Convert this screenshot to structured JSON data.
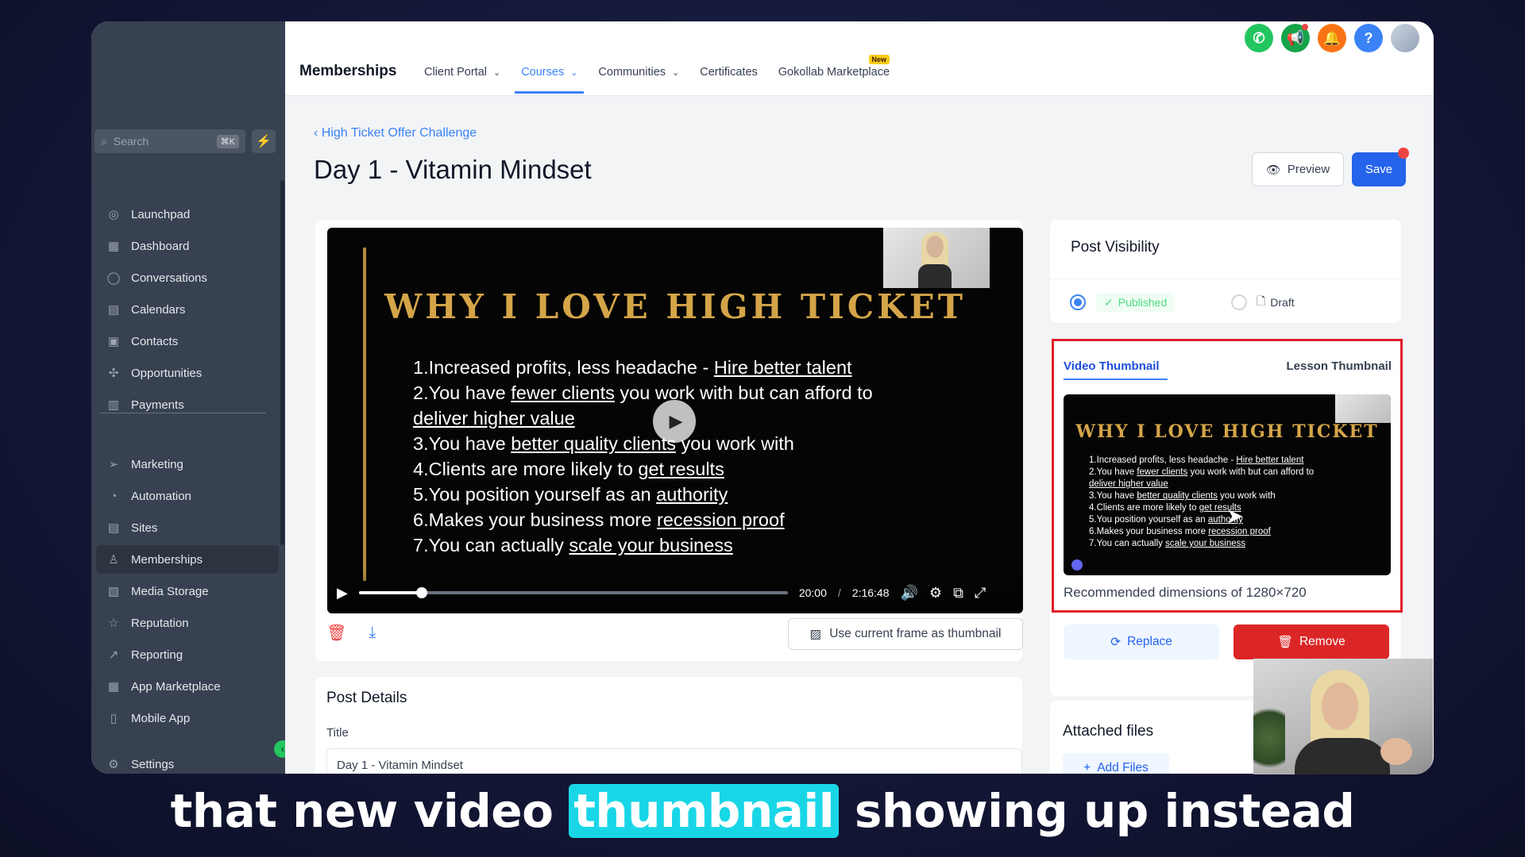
{
  "sidebar": {
    "search_placeholder": "Search",
    "search_shortcut": "⌘K",
    "items": [
      {
        "label": "Launchpad",
        "icon": "launchpad-icon"
      },
      {
        "label": "Dashboard",
        "icon": "dashboard-icon"
      },
      {
        "label": "Conversations",
        "icon": "chat-icon"
      },
      {
        "label": "Calendars",
        "icon": "calendar-icon"
      },
      {
        "label": "Contacts",
        "icon": "contacts-icon"
      },
      {
        "label": "Opportunities",
        "icon": "opportunities-icon"
      },
      {
        "label": "Payments",
        "icon": "payments-icon"
      },
      {
        "label": "Marketing",
        "icon": "send-icon"
      },
      {
        "label": "Automation",
        "icon": "automation-icon"
      },
      {
        "label": "Sites",
        "icon": "sites-icon"
      },
      {
        "label": "Memberships",
        "icon": "memberships-icon",
        "active": true
      },
      {
        "label": "Media Storage",
        "icon": "image-icon"
      },
      {
        "label": "Reputation",
        "icon": "star-icon"
      },
      {
        "label": "Reporting",
        "icon": "trend-icon"
      },
      {
        "label": "App Marketplace",
        "icon": "grid-icon"
      },
      {
        "label": "Mobile App",
        "icon": "mobile-icon"
      },
      {
        "label": "Settings",
        "icon": "gear-icon"
      }
    ]
  },
  "header": {
    "brand": "Memberships",
    "tabs": [
      {
        "label": "Client Portal",
        "dropdown": true
      },
      {
        "label": "Courses",
        "dropdown": true,
        "active": true
      },
      {
        "label": "Communities",
        "dropdown": true
      },
      {
        "label": "Certificates",
        "dropdown": false
      },
      {
        "label": "Gokollab Marketplace",
        "dropdown": false,
        "badge": "New"
      }
    ]
  },
  "page": {
    "breadcrumb": "High Ticket Offer Challenge",
    "title": "Day 1 - Vitamin Mindset",
    "preview_label": "Preview",
    "save_label": "Save"
  },
  "video": {
    "slide_title": "WHY I LOVE HIGH TICKET",
    "slide_points": [
      [
        {
          "t": "1.Increased profits, less headache - "
        },
        {
          "t": "Hire better talent",
          "u": true
        }
      ],
      [
        {
          "t": "2.You have "
        },
        {
          "t": "fewer clients",
          "u": true
        },
        {
          "t": " you work with but can afford to"
        }
      ],
      [
        {
          "t": "   "
        },
        {
          "t": "deliver higher value",
          "u": true
        }
      ],
      [
        {
          "t": "3.You have "
        },
        {
          "t": "better quality clients",
          "u": true
        },
        {
          "t": " you work with"
        }
      ],
      [
        {
          "t": "4.Clients are more likely to "
        },
        {
          "t": "get results",
          "u": true
        }
      ],
      [
        {
          "t": "5.You position yourself as an "
        },
        {
          "t": "authority",
          "u": true
        }
      ],
      [
        {
          "t": "6.Makes your business more "
        },
        {
          "t": "recession proof",
          "u": true
        }
      ],
      [
        {
          "t": "7.You can actually "
        },
        {
          "t": "scale your business",
          "u": true
        }
      ]
    ],
    "current_time": "20:00",
    "separator": "/",
    "duration": "2:16:48",
    "progress_fraction": 0.146,
    "use_frame_label": "Use current frame as thumbnail"
  },
  "post_details": {
    "heading": "Post Details",
    "title_label": "Title",
    "title_value": "Day 1 - Vitamin Mindset"
  },
  "visibility": {
    "heading": "Post Visibility",
    "published_label": "Published",
    "draft_label": "Draft"
  },
  "thumbnail": {
    "tab_video": "Video Thumbnail",
    "tab_lesson": "Lesson Thumbnail",
    "dims_text": "Recommended dimensions of 1280×720",
    "replace_label": "Replace",
    "remove_label": "Remove"
  },
  "files": {
    "heading": "Attached files",
    "add_label": "Add Files"
  },
  "caption": {
    "before": "that new video",
    "highlight": "thumbnail",
    "after": "showing up instead"
  },
  "colors": {
    "accent": "#3b82f6",
    "danger": "#dc2626",
    "highlight_box": "#e11d2a",
    "caption_highlight": "#19d6e6",
    "slide_gold": "#d4a548"
  }
}
